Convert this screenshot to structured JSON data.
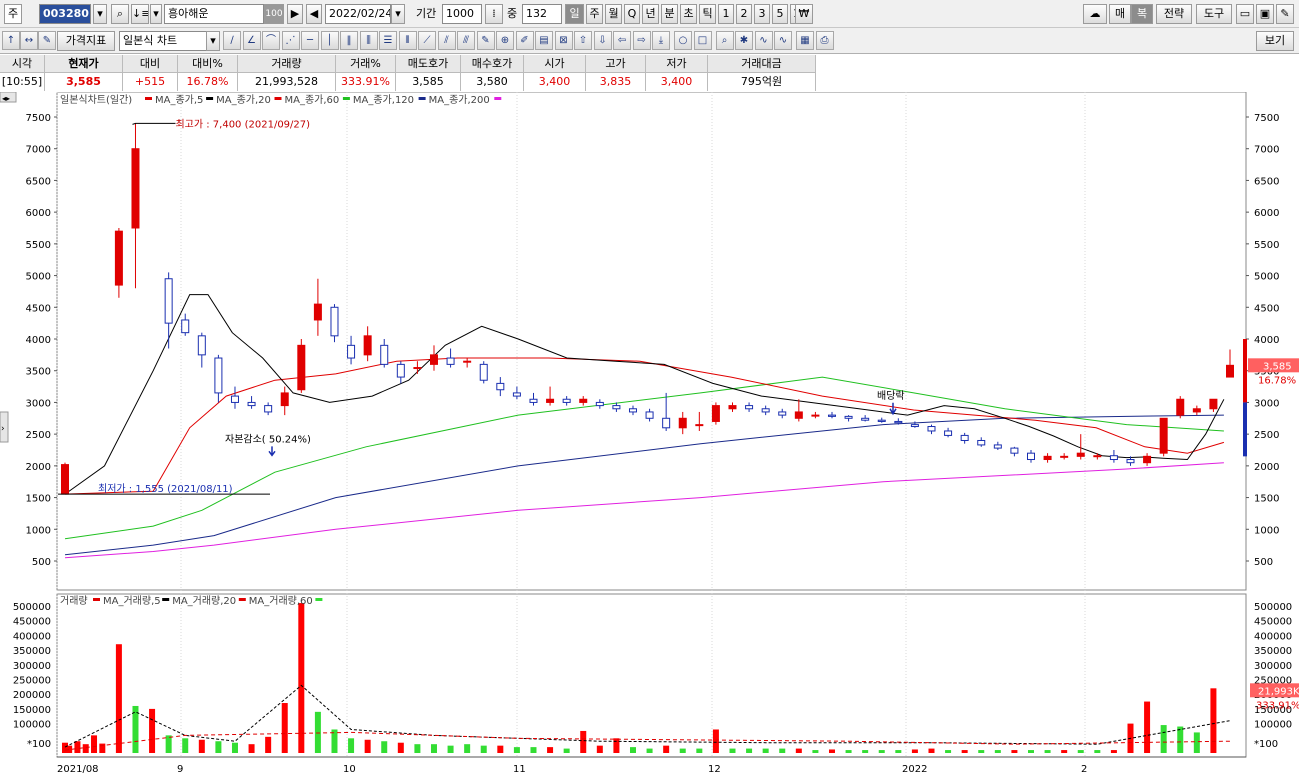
{
  "toolbar": {
    "market_label": "주",
    "stock_code": "003280",
    "stock_name": "흥아해운",
    "stock_name_badge": "100",
    "date": "2022/02/24",
    "period_label": "기간",
    "period_value": "1000",
    "count_label": "중",
    "count_value": "132",
    "period_buttons": [
      "일",
      "주",
      "월",
      "Q",
      "년",
      "분",
      "초",
      "틱",
      "1",
      "2",
      "3",
      "5",
      "15"
    ],
    "right_buttons": [
      "매",
      "복",
      "전략",
      "도구"
    ]
  },
  "toolbar2": {
    "indicator_button": "가격지표",
    "chart_type": "일본식 차트",
    "view_button": "보기"
  },
  "quote": {
    "headers": [
      "시각",
      "현재가",
      "대비",
      "대비%",
      "거래량",
      "거래%",
      "매도호가",
      "매수호가",
      "시가",
      "고가",
      "저가",
      "거래대금"
    ],
    "values": [
      "[10:55]",
      "3,585",
      "+515",
      "16.78%",
      "21,993,528",
      "333.91%",
      "3,585",
      "3,580",
      "3,400",
      "3,835",
      "3,400",
      "795억원"
    ]
  },
  "price_legend": {
    "title": "일본식차트(일간)",
    "items": [
      "MA_종가,5",
      "MA_종가,20",
      "MA_종가,60",
      "MA_종가,120",
      "MA_종가,200"
    ]
  },
  "volume_legend": {
    "title": "거래량",
    "items": [
      "MA_거래량,5",
      "MA_거래량,20",
      "MA_거래량,60"
    ]
  },
  "annotations": {
    "high": "최고가 : 7,400 (2021/09/27)",
    "low": "최저가 : 1,555 (2021/08/11)",
    "capital_reduction": "자본감소( 50.24%)",
    "dividend": "배당락"
  },
  "price_badge": {
    "price": "3,585",
    "pct": "16.78%"
  },
  "volume_badge": {
    "volume": "21,993K",
    "pct": "333.91%"
  },
  "volume_unit": "*100",
  "colors": {
    "up": "#e00000",
    "down": "#1a2fb0",
    "ma5": "#000000",
    "ma20": "#e00000",
    "ma60": "#20c020",
    "ma120": "#1a2a8a",
    "ma200": "#e020e0"
  },
  "chart_data": {
    "type": "candlestick",
    "y_price_ticks": [
      500,
      1000,
      1500,
      2000,
      2500,
      3000,
      3500,
      4000,
      4500,
      5000,
      5500,
      6000,
      6500,
      7000,
      7500
    ],
    "y_volume_ticks": [
      100000,
      150000,
      200000,
      250000,
      300000,
      350000,
      400000,
      450000,
      500000
    ],
    "x_labels": [
      "2021/08",
      "9",
      "10",
      "11",
      "12",
      "2022",
      "2"
    ],
    "candles": [
      [
        1555,
        2050,
        1555,
        2020
      ],
      [
        4850,
        5750,
        4650,
        5700
      ],
      [
        5750,
        7400,
        4800,
        7000
      ],
      [
        4950,
        5050,
        3850,
        4250
      ],
      [
        4300,
        4400,
        4050,
        4100
      ],
      [
        4050,
        4100,
        3550,
        3750
      ],
      [
        3700,
        3750,
        3000,
        3150
      ],
      [
        3100,
        3250,
        2900,
        3000
      ],
      [
        3000,
        3100,
        2900,
        2950
      ],
      [
        2950,
        3000,
        2800,
        2850
      ],
      [
        2950,
        3250,
        2800,
        3150
      ],
      [
        3200,
        4000,
        3150,
        3900
      ],
      [
        4300,
        4950,
        4050,
        4550
      ],
      [
        4500,
        4550,
        3950,
        4050
      ],
      [
        3900,
        4050,
        3600,
        3700
      ],
      [
        3750,
        4200,
        3650,
        4050
      ],
      [
        3900,
        4000,
        3550,
        3600
      ],
      [
        3600,
        3650,
        3300,
        3400
      ],
      [
        3550,
        3650,
        3450,
        3550
      ],
      [
        3600,
        3900,
        3500,
        3750
      ],
      [
        3700,
        3850,
        3550,
        3600
      ],
      [
        3650,
        3700,
        3550,
        3650
      ],
      [
        3600,
        3650,
        3300,
        3350
      ],
      [
        3300,
        3400,
        3100,
        3200
      ],
      [
        3150,
        3250,
        3050,
        3100
      ],
      [
        3050,
        3150,
        2950,
        3000
      ],
      [
        3000,
        3250,
        2950,
        3050
      ],
      [
        3050,
        3100,
        2950,
        3000
      ],
      [
        3000,
        3100,
        2950,
        3050
      ],
      [
        3000,
        3050,
        2900,
        2950
      ],
      [
        2950,
        3000,
        2850,
        2900
      ],
      [
        2900,
        2950,
        2800,
        2850
      ],
      [
        2850,
        2900,
        2700,
        2750
      ],
      [
        2750,
        3150,
        2550,
        2600
      ],
      [
        2600,
        2850,
        2500,
        2750
      ],
      [
        2650,
        2850,
        2550,
        2650
      ],
      [
        2700,
        3000,
        2650,
        2950
      ],
      [
        2900,
        3000,
        2850,
        2950
      ],
      [
        2950,
        3000,
        2850,
        2900
      ],
      [
        2900,
        2950,
        2800,
        2850
      ],
      [
        2850,
        2900,
        2750,
        2800
      ],
      [
        2750,
        3050,
        2700,
        2850
      ],
      [
        2800,
        2850,
        2750,
        2800
      ],
      [
        2800,
        2850,
        2750,
        2780
      ],
      [
        2780,
        2800,
        2700,
        2750
      ],
      [
        2750,
        2800,
        2700,
        2720
      ],
      [
        2720,
        2760,
        2680,
        2700
      ],
      [
        2700,
        2750,
        2650,
        2680
      ],
      [
        2650,
        2700,
        2600,
        2620
      ],
      [
        2620,
        2650,
        2500,
        2550
      ],
      [
        2550,
        2600,
        2450,
        2480
      ],
      [
        2480,
        2520,
        2350,
        2400
      ],
      [
        2400,
        2450,
        2300,
        2330
      ],
      [
        2330,
        2380,
        2250,
        2280
      ],
      [
        2280,
        2300,
        2150,
        2200
      ],
      [
        2200,
        2250,
        2050,
        2100
      ],
      [
        2100,
        2200,
        2050,
        2150
      ],
      [
        2150,
        2200,
        2100,
        2150
      ],
      [
        2150,
        2500,
        2100,
        2200
      ],
      [
        2150,
        2200,
        2100,
        2160
      ],
      [
        2160,
        2250,
        2050,
        2100
      ],
      [
        2100,
        2150,
        2000,
        2050
      ],
      [
        2050,
        2200,
        2000,
        2150
      ],
      [
        2200,
        2750,
        2150,
        2750
      ],
      [
        2800,
        3100,
        2750,
        3050
      ],
      [
        2850,
        2950,
        2800,
        2900
      ],
      [
        2900,
        3050,
        2850,
        3050
      ],
      [
        3400,
        3835,
        3400,
        3585
      ]
    ],
    "ma5": [
      [
        1555,
        1555
      ],
      [
        1620,
        2000
      ],
      [
        1700,
        3500
      ],
      [
        1760,
        4700
      ],
      [
        1790,
        4700
      ],
      [
        1830,
        4100
      ],
      [
        1880,
        3700
      ],
      [
        1930,
        3150
      ],
      [
        1990,
        3000
      ],
      [
        2060,
        3100
      ],
      [
        2120,
        3350
      ],
      [
        2180,
        3900
      ],
      [
        2240,
        4200
      ],
      [
        2300,
        4000
      ],
      [
        2380,
        3700
      ],
      [
        2460,
        3650
      ],
      [
        2540,
        3600
      ],
      [
        2620,
        3300
      ],
      [
        2700,
        3100
      ],
      [
        2780,
        3000
      ],
      [
        2860,
        2900
      ],
      [
        2940,
        2800
      ],
      [
        3000,
        2950
      ],
      [
        3050,
        2900
      ],
      [
        3100,
        2750
      ],
      [
        3140,
        2620
      ],
      [
        3180,
        2470
      ],
      [
        3220,
        2300
      ],
      [
        3260,
        2160
      ],
      [
        3300,
        2130
      ],
      [
        3330,
        2140
      ],
      [
        3360,
        2120
      ],
      [
        3400,
        2100
      ],
      [
        3430,
        2500
      ],
      [
        3460,
        3050
      ]
    ],
    "ma20": [
      [
        1555,
        1555
      ],
      [
        1700,
        1600
      ],
      [
        1760,
        2600
      ],
      [
        1820,
        3100
      ],
      [
        1900,
        3350
      ],
      [
        2000,
        3450
      ],
      [
        2100,
        3650
      ],
      [
        2200,
        3700
      ],
      [
        2350,
        3700
      ],
      [
        2500,
        3650
      ],
      [
        2650,
        3400
      ],
      [
        2800,
        3100
      ],
      [
        2950,
        2880
      ],
      [
        3050,
        2800
      ],
      [
        3150,
        2720
      ],
      [
        3250,
        2600
      ],
      [
        3330,
        2300
      ],
      [
        3400,
        2200
      ],
      [
        3460,
        2370
      ]
    ],
    "ma60": [
      [
        1555,
        850
      ],
      [
        1700,
        1050
      ],
      [
        1780,
        1300
      ],
      [
        1900,
        1900
      ],
      [
        2050,
        2300
      ],
      [
        2300,
        2800
      ],
      [
        2600,
        3150
      ],
      [
        2800,
        3400
      ],
      [
        2950,
        3150
      ],
      [
        3100,
        2900
      ],
      [
        3300,
        2650
      ],
      [
        3460,
        2550
      ]
    ],
    "ma120": [
      [
        1555,
        600
      ],
      [
        1700,
        750
      ],
      [
        1800,
        900
      ],
      [
        2000,
        1500
      ],
      [
        2300,
        2000
      ],
      [
        2600,
        2350
      ],
      [
        2900,
        2650
      ],
      [
        3100,
        2750
      ],
      [
        3300,
        2780
      ],
      [
        3460,
        2800
      ]
    ],
    "ma200": [
      [
        1555,
        550
      ],
      [
        1700,
        650
      ],
      [
        1800,
        750
      ],
      [
        2000,
        1000
      ],
      [
        2300,
        1300
      ],
      [
        2600,
        1500
      ],
      [
        2900,
        1750
      ],
      [
        3100,
        1850
      ],
      [
        3300,
        1950
      ],
      [
        3460,
        2050
      ]
    ],
    "volumes": [
      [
        1555,
        35000,
        "up"
      ],
      [
        1560,
        25000,
        "up"
      ],
      [
        1570,
        40000,
        "up"
      ],
      [
        1580,
        30000,
        "up"
      ],
      [
        1590,
        60000,
        "up"
      ],
      [
        1600,
        32000,
        "up"
      ],
      [
        1620,
        370000,
        "up"
      ],
      [
        1640,
        160000,
        "down"
      ],
      [
        1660,
        150000,
        "up"
      ],
      [
        1680,
        60000,
        "down"
      ],
      [
        1700,
        50000,
        "down"
      ],
      [
        1720,
        45000,
        "up"
      ],
      [
        1740,
        40000,
        "down"
      ],
      [
        1760,
        35000,
        "down"
      ],
      [
        1780,
        30000,
        "up"
      ],
      [
        1800,
        55000,
        "up"
      ],
      [
        1820,
        170000,
        "up"
      ],
      [
        1840,
        510000,
        "up"
      ],
      [
        1860,
        140000,
        "down"
      ],
      [
        1880,
        80000,
        "down"
      ],
      [
        1900,
        50000,
        "down"
      ],
      [
        1920,
        45000,
        "up"
      ],
      [
        1940,
        40000,
        "down"
      ],
      [
        1960,
        35000,
        "up"
      ],
      [
        1980,
        30000,
        "down"
      ],
      [
        2000,
        30000,
        "down"
      ],
      [
        2020,
        25000,
        "down"
      ],
      [
        2040,
        30000,
        "down"
      ],
      [
        2060,
        25000,
        "down"
      ],
      [
        2080,
        25000,
        "up"
      ],
      [
        2100,
        20000,
        "down"
      ],
      [
        2120,
        20000,
        "down"
      ],
      [
        2140,
        20000,
        "up"
      ],
      [
        2160,
        15000,
        "down"
      ],
      [
        2180,
        75000,
        "up"
      ],
      [
        2200,
        25000,
        "up"
      ],
      [
        2220,
        50000,
        "up"
      ],
      [
        2240,
        20000,
        "down"
      ],
      [
        2260,
        15000,
        "down"
      ],
      [
        2280,
        25000,
        "up"
      ],
      [
        2300,
        15000,
        "down"
      ],
      [
        2320,
        15000,
        "down"
      ],
      [
        2340,
        80000,
        "up"
      ],
      [
        2360,
        15000,
        "down"
      ],
      [
        2380,
        15000,
        "down"
      ],
      [
        2400,
        15000,
        "down"
      ],
      [
        2420,
        15000,
        "down"
      ],
      [
        2440,
        15000,
        "up"
      ],
      [
        2460,
        10000,
        "down"
      ],
      [
        2480,
        12000,
        "up"
      ],
      [
        2500,
        10000,
        "down"
      ],
      [
        2520,
        10000,
        "down"
      ],
      [
        2540,
        10000,
        "down"
      ],
      [
        2560,
        10000,
        "down"
      ],
      [
        2580,
        12000,
        "up"
      ],
      [
        2600,
        15000,
        "up"
      ],
      [
        2620,
        10000,
        "down"
      ],
      [
        2640,
        10000,
        "up"
      ],
      [
        2660,
        10000,
        "down"
      ],
      [
        2680,
        10000,
        "down"
      ],
      [
        2700,
        10000,
        "up"
      ],
      [
        2720,
        10000,
        "down"
      ],
      [
        2740,
        10000,
        "down"
      ],
      [
        2760,
        10000,
        "up"
      ],
      [
        2780,
        10000,
        "down"
      ],
      [
        2800,
        10000,
        "down"
      ],
      [
        2820,
        10000,
        "up"
      ],
      [
        2840,
        100000,
        "up"
      ],
      [
        2860,
        175000,
        "up"
      ],
      [
        2880,
        95000,
        "down"
      ],
      [
        2900,
        90000,
        "down"
      ],
      [
        2920,
        70000,
        "down"
      ],
      [
        2940,
        220000,
        "up"
      ]
    ]
  }
}
